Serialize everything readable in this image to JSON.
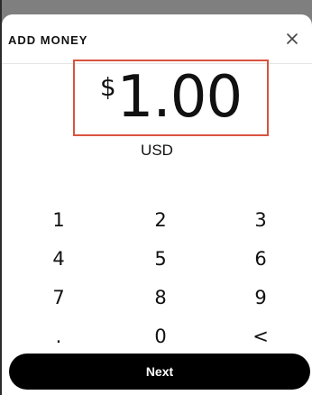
{
  "sheet": {
    "title": "ADD MONEY",
    "close_icon": "close-icon"
  },
  "amount": {
    "symbol": "$",
    "value": "1.00",
    "currency": "USD"
  },
  "keypad": {
    "keys": [
      "1",
      "2",
      "3",
      "4",
      "5",
      "6",
      "7",
      "8",
      "9",
      ".",
      "0",
      "<"
    ]
  },
  "footer": {
    "next_label": "Next"
  },
  "colors": {
    "highlight_border": "#d9533f",
    "next_button_bg": "#000000",
    "backdrop": "#7f7f7f"
  }
}
